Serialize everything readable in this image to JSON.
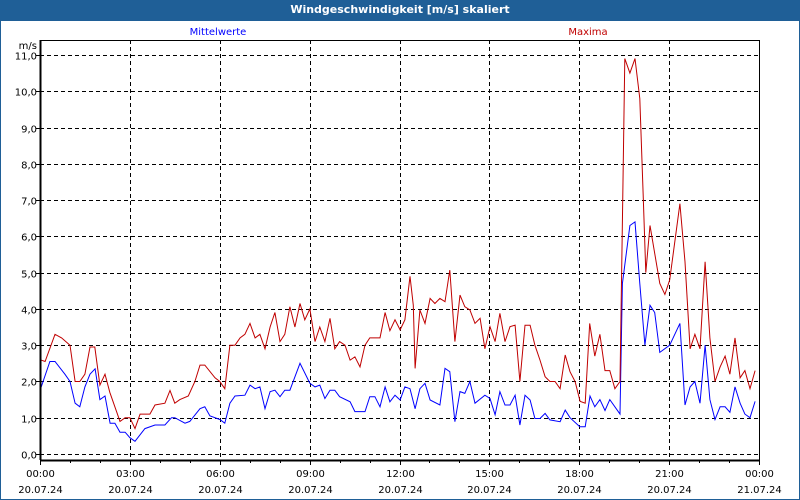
{
  "chart_data": {
    "type": "line",
    "title": "Windgeschwindigkeit [m/s] skaliert",
    "ylabel": "m/s",
    "ylim": [
      0,
      11
    ],
    "yticks": [
      0,
      1,
      2,
      3,
      4,
      5,
      6,
      7,
      8,
      9,
      10,
      11
    ],
    "ytick_labels": [
      "0,0",
      "1,0",
      "2,0",
      "3,0",
      "4,0",
      "5,0",
      "6,0",
      "7,0",
      "8,0",
      "9,0",
      "10,0",
      "11,0"
    ],
    "xlim_hours": [
      0,
      24
    ],
    "xticks": [
      {
        "hour": 0,
        "time": "00:00",
        "date": "20.07.24"
      },
      {
        "hour": 3,
        "time": "03:00",
        "date": "20.07.24"
      },
      {
        "hour": 6,
        "time": "06:00",
        "date": "20.07.24"
      },
      {
        "hour": 9,
        "time": "09:00",
        "date": "20.07.24"
      },
      {
        "hour": 12,
        "time": "12:00",
        "date": "20.07.24"
      },
      {
        "hour": 15,
        "time": "15:00",
        "date": "20.07.24"
      },
      {
        "hour": 18,
        "time": "18:00",
        "date": "20.07.24"
      },
      {
        "hour": 21,
        "time": "21:00",
        "date": "20.07.24"
      },
      {
        "hour": 24,
        "time": "00:00",
        "date": "21.07.24"
      }
    ],
    "grid": true,
    "series": [
      {
        "name": "Mittelwerte",
        "color": "#0000ff",
        "points": [
          [
            0,
            1.75
          ],
          [
            0.33,
            2.55
          ],
          [
            0.5,
            2.55
          ],
          [
            0.83,
            2.2
          ],
          [
            1.0,
            2.0
          ],
          [
            1.17,
            1.4
          ],
          [
            1.33,
            1.3
          ],
          [
            1.5,
            1.85
          ],
          [
            1.67,
            2.2
          ],
          [
            1.84,
            2.35
          ],
          [
            2.0,
            1.5
          ],
          [
            2.17,
            1.6
          ],
          [
            2.34,
            0.85
          ],
          [
            2.5,
            0.85
          ],
          [
            2.67,
            0.6
          ],
          [
            2.84,
            0.6
          ],
          [
            3.0,
            0.45
          ],
          [
            3.17,
            0.35
          ],
          [
            3.5,
            0.7
          ],
          [
            3.84,
            0.8
          ],
          [
            4.17,
            0.8
          ],
          [
            4.39,
            1.0
          ],
          [
            4.5,
            1.0
          ],
          [
            4.84,
            0.85
          ],
          [
            5.0,
            0.9
          ],
          [
            5.34,
            1.25
          ],
          [
            5.5,
            1.3
          ],
          [
            5.67,
            1.05
          ],
          [
            6.0,
            0.95
          ],
          [
            6.17,
            0.85
          ],
          [
            6.34,
            1.4
          ],
          [
            6.51,
            1.6
          ],
          [
            6.84,
            1.62
          ],
          [
            7.01,
            1.9
          ],
          [
            7.18,
            1.8
          ],
          [
            7.34,
            1.85
          ],
          [
            7.51,
            1.25
          ],
          [
            7.68,
            1.72
          ],
          [
            7.84,
            1.76
          ],
          [
            8.01,
            1.58
          ],
          [
            8.17,
            1.76
          ],
          [
            8.34,
            1.76
          ],
          [
            8.68,
            2.5
          ],
          [
            9.01,
            1.95
          ],
          [
            9.18,
            1.85
          ],
          [
            9.34,
            1.9
          ],
          [
            9.51,
            1.53
          ],
          [
            9.68,
            1.76
          ],
          [
            9.84,
            1.76
          ],
          [
            10.0,
            1.58
          ],
          [
            10.35,
            1.44
          ],
          [
            10.51,
            1.17
          ],
          [
            10.85,
            1.17
          ],
          [
            11.01,
            1.58
          ],
          [
            11.18,
            1.58
          ],
          [
            11.35,
            1.3
          ],
          [
            11.52,
            1.85
          ],
          [
            11.68,
            1.44
          ],
          [
            11.85,
            1.62
          ],
          [
            12.02,
            1.49
          ],
          [
            12.18,
            1.85
          ],
          [
            12.35,
            1.8
          ],
          [
            12.52,
            1.25
          ],
          [
            12.68,
            1.8
          ],
          [
            12.85,
            1.95
          ],
          [
            13.02,
            1.49
          ],
          [
            13.35,
            1.35
          ],
          [
            13.52,
            2.36
          ],
          [
            13.68,
            2.27
          ],
          [
            13.85,
            0.89
          ],
          [
            14.02,
            1.72
          ],
          [
            14.18,
            1.67
          ],
          [
            14.35,
            2.0
          ],
          [
            14.52,
            1.4
          ],
          [
            14.85,
            1.62
          ],
          [
            15.02,
            1.53
          ],
          [
            15.19,
            1.08
          ],
          [
            15.35,
            1.72
          ],
          [
            15.52,
            1.35
          ],
          [
            15.69,
            1.35
          ],
          [
            15.86,
            1.62
          ],
          [
            16.02,
            0.8
          ],
          [
            16.19,
            1.62
          ],
          [
            16.36,
            1.49
          ],
          [
            16.52,
            0.98
          ],
          [
            16.69,
            0.98
          ],
          [
            16.86,
            1.12
          ],
          [
            17.02,
            0.94
          ],
          [
            17.36,
            0.89
          ],
          [
            17.53,
            1.21
          ],
          [
            17.69,
            1.0
          ],
          [
            18.02,
            0.75
          ],
          [
            18.2,
            0.75
          ],
          [
            18.36,
            1.6
          ],
          [
            18.52,
            1.3
          ],
          [
            18.69,
            1.5
          ],
          [
            18.86,
            1.2
          ],
          [
            19.02,
            1.5
          ],
          [
            19.36,
            1.1
          ],
          [
            19.44,
            4.7
          ],
          [
            19.69,
            6.3
          ],
          [
            19.86,
            6.4
          ],
          [
            20.02,
            4.7
          ],
          [
            20.19,
            3.0
          ],
          [
            20.36,
            4.1
          ],
          [
            20.52,
            3.9
          ],
          [
            20.69,
            2.8
          ],
          [
            21.02,
            3.0
          ],
          [
            21.36,
            3.6
          ],
          [
            21.53,
            1.35
          ],
          [
            21.7,
            1.85
          ],
          [
            21.86,
            2.0
          ],
          [
            22.03,
            1.4
          ],
          [
            22.2,
            3.0
          ],
          [
            22.36,
            1.5
          ],
          [
            22.53,
            0.95
          ],
          [
            22.7,
            1.3
          ],
          [
            22.87,
            1.3
          ],
          [
            23.03,
            1.15
          ],
          [
            23.2,
            1.85
          ],
          [
            23.37,
            1.4
          ],
          [
            23.53,
            1.1
          ],
          [
            23.7,
            1.0
          ],
          [
            23.87,
            1.45
          ]
        ]
      },
      {
        "name": "Maxima",
        "color": "#c00000",
        "points": [
          [
            0,
            2.6
          ],
          [
            0.17,
            2.55
          ],
          [
            0.5,
            3.3
          ],
          [
            0.72,
            3.2
          ],
          [
            1.0,
            3.0
          ],
          [
            1.17,
            2.0
          ],
          [
            1.33,
            2.0
          ],
          [
            1.5,
            2.2
          ],
          [
            1.67,
            2.95
          ],
          [
            1.83,
            2.95
          ],
          [
            2.0,
            1.9
          ],
          [
            2.17,
            2.2
          ],
          [
            2.33,
            1.7
          ],
          [
            2.67,
            0.9
          ],
          [
            2.84,
            1.0
          ],
          [
            3.0,
            1.0
          ],
          [
            3.17,
            0.7
          ],
          [
            3.34,
            1.1
          ],
          [
            3.67,
            1.1
          ],
          [
            3.84,
            1.35
          ],
          [
            4.17,
            1.4
          ],
          [
            4.34,
            1.75
          ],
          [
            4.5,
            1.4
          ],
          [
            4.67,
            1.5
          ],
          [
            4.95,
            1.6
          ],
          [
            5.17,
            2.0
          ],
          [
            5.34,
            2.45
          ],
          [
            5.5,
            2.45
          ],
          [
            5.84,
            2.1
          ],
          [
            6.0,
            2.0
          ],
          [
            6.17,
            1.8
          ],
          [
            6.34,
            3.0
          ],
          [
            6.51,
            3.0
          ],
          [
            6.68,
            3.2
          ],
          [
            6.84,
            3.3
          ],
          [
            7.01,
            3.6
          ],
          [
            7.18,
            3.2
          ],
          [
            7.34,
            3.3
          ],
          [
            7.51,
            2.9
          ],
          [
            7.68,
            3.5
          ],
          [
            7.84,
            3.9
          ],
          [
            8.01,
            3.1
          ],
          [
            8.17,
            3.3
          ],
          [
            8.34,
            4.06
          ],
          [
            8.51,
            3.5
          ],
          [
            8.68,
            4.15
          ],
          [
            8.84,
            3.7
          ],
          [
            9.01,
            4.0
          ],
          [
            9.18,
            3.1
          ],
          [
            9.34,
            3.5
          ],
          [
            9.51,
            3.1
          ],
          [
            9.68,
            3.74
          ],
          [
            9.84,
            2.9
          ],
          [
            10.0,
            3.1
          ],
          [
            10.18,
            3.0
          ],
          [
            10.35,
            2.59
          ],
          [
            10.51,
            2.68
          ],
          [
            10.68,
            2.4
          ],
          [
            10.85,
            3.0
          ],
          [
            11.01,
            3.2
          ],
          [
            11.35,
            3.2
          ],
          [
            11.52,
            3.9
          ],
          [
            11.68,
            3.4
          ],
          [
            11.85,
            3.7
          ],
          [
            12.02,
            3.42
          ],
          [
            12.18,
            3.7
          ],
          [
            12.35,
            4.9
          ],
          [
            12.46,
            4.1
          ],
          [
            12.52,
            2.36
          ],
          [
            12.68,
            3.97
          ],
          [
            12.85,
            3.6
          ],
          [
            13.02,
            4.29
          ],
          [
            13.18,
            4.15
          ],
          [
            13.35,
            4.29
          ],
          [
            13.52,
            4.2
          ],
          [
            13.68,
            5.07
          ],
          [
            13.85,
            3.1
          ],
          [
            14.02,
            4.38
          ],
          [
            14.18,
            4.06
          ],
          [
            14.35,
            3.97
          ],
          [
            14.52,
            3.6
          ],
          [
            14.69,
            3.74
          ],
          [
            14.85,
            2.9
          ],
          [
            15.02,
            3.51
          ],
          [
            15.19,
            3.1
          ],
          [
            15.35,
            3.88
          ],
          [
            15.52,
            3.1
          ],
          [
            15.69,
            3.51
          ],
          [
            15.86,
            3.55
          ],
          [
            16.02,
            2.0
          ],
          [
            16.19,
            3.55
          ],
          [
            16.36,
            3.55
          ],
          [
            16.52,
            3.0
          ],
          [
            16.69,
            2.59
          ],
          [
            16.86,
            2.13
          ],
          [
            17.02,
            2.0
          ],
          [
            17.19,
            2.0
          ],
          [
            17.36,
            1.8
          ],
          [
            17.53,
            2.73
          ],
          [
            17.69,
            2.27
          ],
          [
            17.86,
            2.0
          ],
          [
            18.03,
            1.45
          ],
          [
            18.2,
            1.4
          ],
          [
            18.35,
            3.6
          ],
          [
            18.52,
            2.7
          ],
          [
            18.69,
            3.3
          ],
          [
            18.86,
            2.3
          ],
          [
            19.02,
            2.3
          ],
          [
            19.19,
            1.8
          ],
          [
            19.36,
            2.0
          ],
          [
            19.44,
            6.4
          ],
          [
            19.52,
            10.9
          ],
          [
            19.69,
            10.5
          ],
          [
            19.86,
            10.9
          ],
          [
            20.02,
            9.8
          ],
          [
            20.13,
            7.2
          ],
          [
            20.22,
            5.0
          ],
          [
            20.36,
            6.3
          ],
          [
            20.69,
            4.7
          ],
          [
            20.86,
            4.4
          ],
          [
            21.02,
            4.8
          ],
          [
            21.36,
            6.9
          ],
          [
            21.53,
            5.3
          ],
          [
            21.7,
            2.9
          ],
          [
            21.86,
            3.3
          ],
          [
            22.03,
            2.9
          ],
          [
            22.2,
            5.3
          ],
          [
            22.36,
            3.2
          ],
          [
            22.53,
            2.0
          ],
          [
            22.7,
            2.4
          ],
          [
            22.87,
            2.7
          ],
          [
            23.03,
            2.2
          ],
          [
            23.2,
            3.2
          ],
          [
            23.37,
            2.1
          ],
          [
            23.53,
            2.3
          ],
          [
            23.7,
            1.8
          ],
          [
            23.87,
            2.3
          ]
        ]
      }
    ]
  }
}
